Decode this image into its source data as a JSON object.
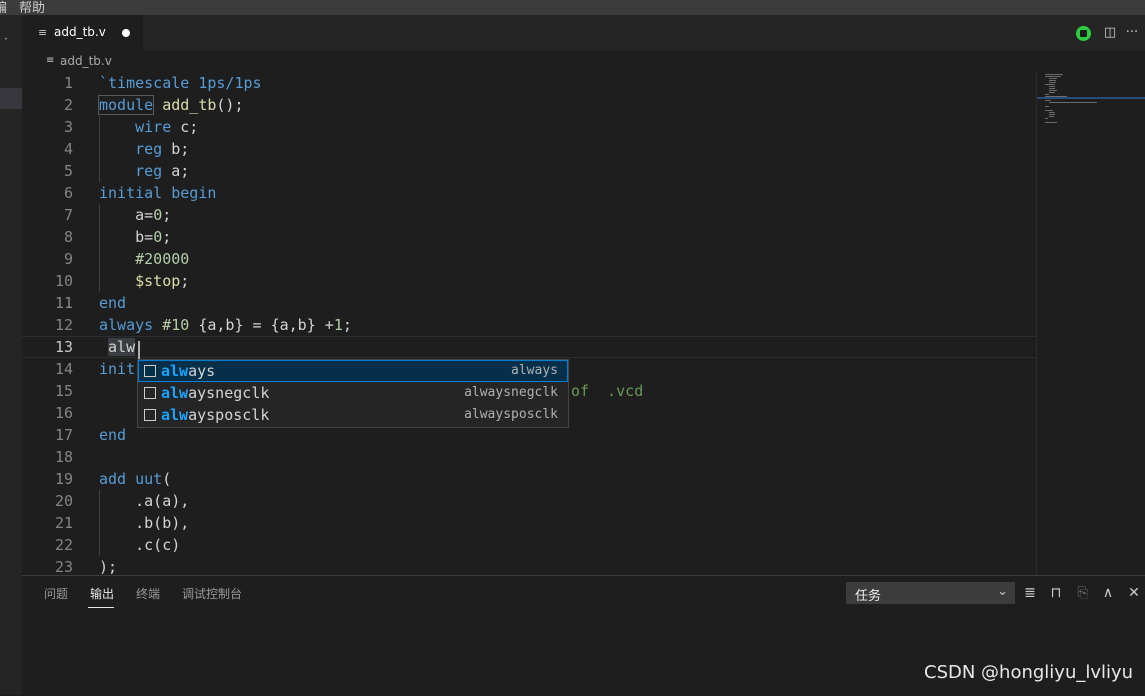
{
  "menubar": {
    "items": [
      "编",
      "帮助"
    ]
  },
  "tab": {
    "label": "add_tb.v"
  },
  "breadcrumb": {
    "file": "add_tb.v"
  },
  "editor": {
    "current_line": 13,
    "lines": [
      {
        "n": "1"
      },
      {
        "n": "2"
      },
      {
        "n": "3"
      },
      {
        "n": "4"
      },
      {
        "n": "5"
      },
      {
        "n": "6"
      },
      {
        "n": "7"
      },
      {
        "n": "8"
      },
      {
        "n": "9"
      },
      {
        "n": "10"
      },
      {
        "n": "11"
      },
      {
        "n": "12"
      },
      {
        "n": "13"
      },
      {
        "n": "14"
      },
      {
        "n": "15"
      },
      {
        "n": "16"
      },
      {
        "n": "17"
      },
      {
        "n": "18"
      },
      {
        "n": "19"
      },
      {
        "n": "20"
      },
      {
        "n": "21"
      },
      {
        "n": "22"
      },
      {
        "n": "23"
      }
    ],
    "code": {
      "l1": "`timescale 1ps/1ps",
      "l2_kw": "module",
      "l2_name": "add_tb",
      "l2_rest": "();",
      "l3_kw": "wire",
      "l3_rest": " c;",
      "l4_kw": "reg",
      "l4_rest": " b;",
      "l5_kw": "reg",
      "l5_rest": " a;",
      "l6_kw1": "initial",
      "l6_kw2": "begin",
      "l7_a": "a=",
      "l7_n": "0",
      "l7_e": ";",
      "l8_a": "b=",
      "l8_n": "0",
      "l8_e": ";",
      "l9": "#20000",
      "l10_fn": "$stop",
      "l10_e": ";",
      "l11": "end",
      "l12_kw": "always",
      "l12_num": "#10",
      "l12_mid": " {a,b} = {a,b} +",
      "l12_n": "1",
      "l12_e": ";",
      "l13": "alw",
      "l14": "init",
      "l15_tail": "of  .vcd",
      "l17": "end",
      "l19_kw": "add",
      "l19_name": "uut",
      "l19_e": "(",
      "l20": ".a(a),",
      "l21": ".b(b),",
      "l22": ".c(c)",
      "l23": ");"
    }
  },
  "suggestions": [
    {
      "match": "alw",
      "rest": "ays",
      "detail": "always"
    },
    {
      "match": "alw",
      "rest": "aysnegclk",
      "detail": "alwaysnegclk"
    },
    {
      "match": "alw",
      "rest": "aysposclk",
      "detail": "alwaysposclk"
    }
  ],
  "panel": {
    "tabs": [
      "问题",
      "输出",
      "终端",
      "调试控制台"
    ],
    "active_tab": "输出",
    "select_value": "任务"
  },
  "watermark": "CSDN @hongliyu_lvliyu",
  "colors": {
    "accent": "#007fd4",
    "keyword": "#569cd6",
    "function": "#dcdcaa",
    "number": "#b5cea8",
    "comment": "#6a9955"
  }
}
